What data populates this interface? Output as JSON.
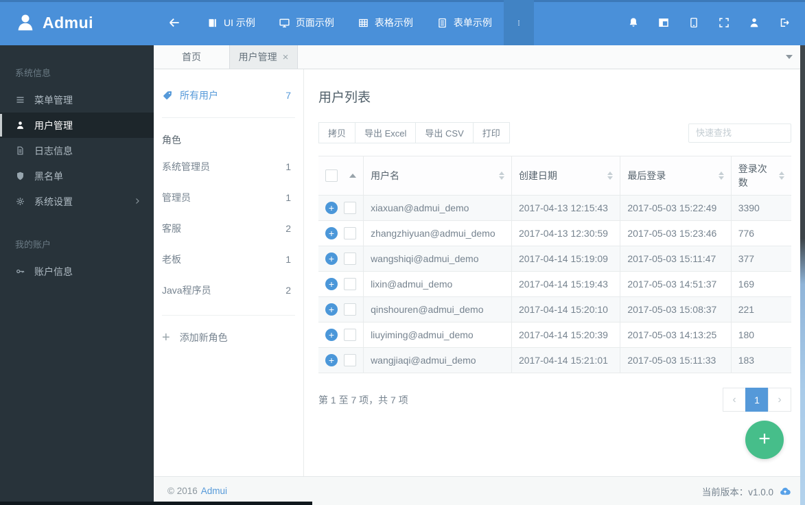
{
  "colors": {
    "primary_blue": "#4a90d9",
    "accent_blue": "#5599d9",
    "sidebar_dark": "#28333a",
    "sidebar_active": "#1d262b",
    "fab_green": "#46be8a",
    "table_border": "#e8ebec",
    "row_stripe": "#f7f9fa",
    "text_muted": "#76838f"
  },
  "icons": {
    "logo-icon": "person silhouette",
    "back-icon": "←",
    "book-icon": "▮▏",
    "monitor-icon": "🖵",
    "table-icon": "grid",
    "form-icon": "lined document",
    "more-dots-icon": "⋮",
    "bell-icon": "🔔",
    "layout-icon": "window with header+sidebar",
    "tablet-icon": "▯",
    "fullscreen-icon": "⛶",
    "user-icon": "👤",
    "logout-icon": "exit arrow",
    "menu-icon": "≡",
    "file-icon": "🗎",
    "shield-icon": "🛡",
    "gear-icon": "⚙",
    "key-icon": "🔑",
    "chevron-right-icon": "›",
    "tag-icon": "🏷",
    "close-icon": "×",
    "caret-down-icon": "▼",
    "sort-asc-icon": "▲",
    "sort-both-icon": "▲▼",
    "plus-icon": "+",
    "cloud-upload-icon": "☁↑"
  },
  "topbar": {
    "brand": "Admui",
    "nav_items": [
      {
        "label": "UI 示例"
      },
      {
        "label": "页面示例"
      },
      {
        "label": "表格示例"
      },
      {
        "label": "表单示例"
      }
    ]
  },
  "sidebar": {
    "section_system_label": "系统信息",
    "section_account_label": "我的账户",
    "items": [
      {
        "label": "菜单管理"
      },
      {
        "label": "用户管理",
        "active": true
      },
      {
        "label": "日志信息"
      },
      {
        "label": "黑名单"
      },
      {
        "label": "系统设置"
      },
      {
        "label": "账户信息"
      }
    ]
  },
  "tabs": {
    "home_label": "首页",
    "active_label": "用户管理",
    "close_glyph": "×"
  },
  "panel": {
    "all_users_label": "所有用户",
    "all_users_count": "7",
    "roles_header": "角色",
    "roles": [
      {
        "name": "系统管理员",
        "count": "1"
      },
      {
        "name": "管理员",
        "count": "1"
      },
      {
        "name": "客服",
        "count": "2"
      },
      {
        "name": "老板",
        "count": "1"
      },
      {
        "name": "Java程序员",
        "count": "2"
      }
    ],
    "add_role_label": "添加新角色"
  },
  "main": {
    "title": "用户列表",
    "toolbar": {
      "copy": "拷贝",
      "excel": "导出 Excel",
      "csv": "导出 CSV",
      "print": "打印"
    },
    "search_placeholder": "快速查找",
    "table": {
      "columns": [
        "用户名",
        "创建日期",
        "最后登录",
        "登录次数"
      ],
      "rows": [
        {
          "username": "xiaxuan@admui_demo",
          "created": "2017-04-13 12:15:43",
          "last_login": "2017-05-03 15:22:49",
          "logins": "3390"
        },
        {
          "username": "zhangzhiyuan@admui_demo",
          "created": "2017-04-13 12:30:59",
          "last_login": "2017-05-03 15:23:46",
          "logins": "776"
        },
        {
          "username": "wangshiqi@admui_demo",
          "created": "2017-04-14 15:19:09",
          "last_login": "2017-05-03 15:11:47",
          "logins": "377"
        },
        {
          "username": "lixin@admui_demo",
          "created": "2017-04-14 15:19:43",
          "last_login": "2017-05-03 14:51:37",
          "logins": "169"
        },
        {
          "username": "qinshouren@admui_demo",
          "created": "2017-04-14 15:20:10",
          "last_login": "2017-05-03 15:08:37",
          "logins": "221"
        },
        {
          "username": "liuyiming@admui_demo",
          "created": "2017-04-14 15:20:39",
          "last_login": "2017-05-03 14:13:25",
          "logins": "180"
        },
        {
          "username": "wangjiaqi@admui_demo",
          "created": "2017-04-14 15:21:01",
          "last_login": "2017-05-03 15:11:33",
          "logins": "183"
        }
      ]
    },
    "info": "第 1 至 7 项，共 7 项",
    "pagination": {
      "prev": "‹",
      "page": "1",
      "next": "›"
    }
  },
  "footer": {
    "copyright": "© 2016",
    "brand_link": "Admui",
    "version": "当前版本：v1.0.0"
  }
}
